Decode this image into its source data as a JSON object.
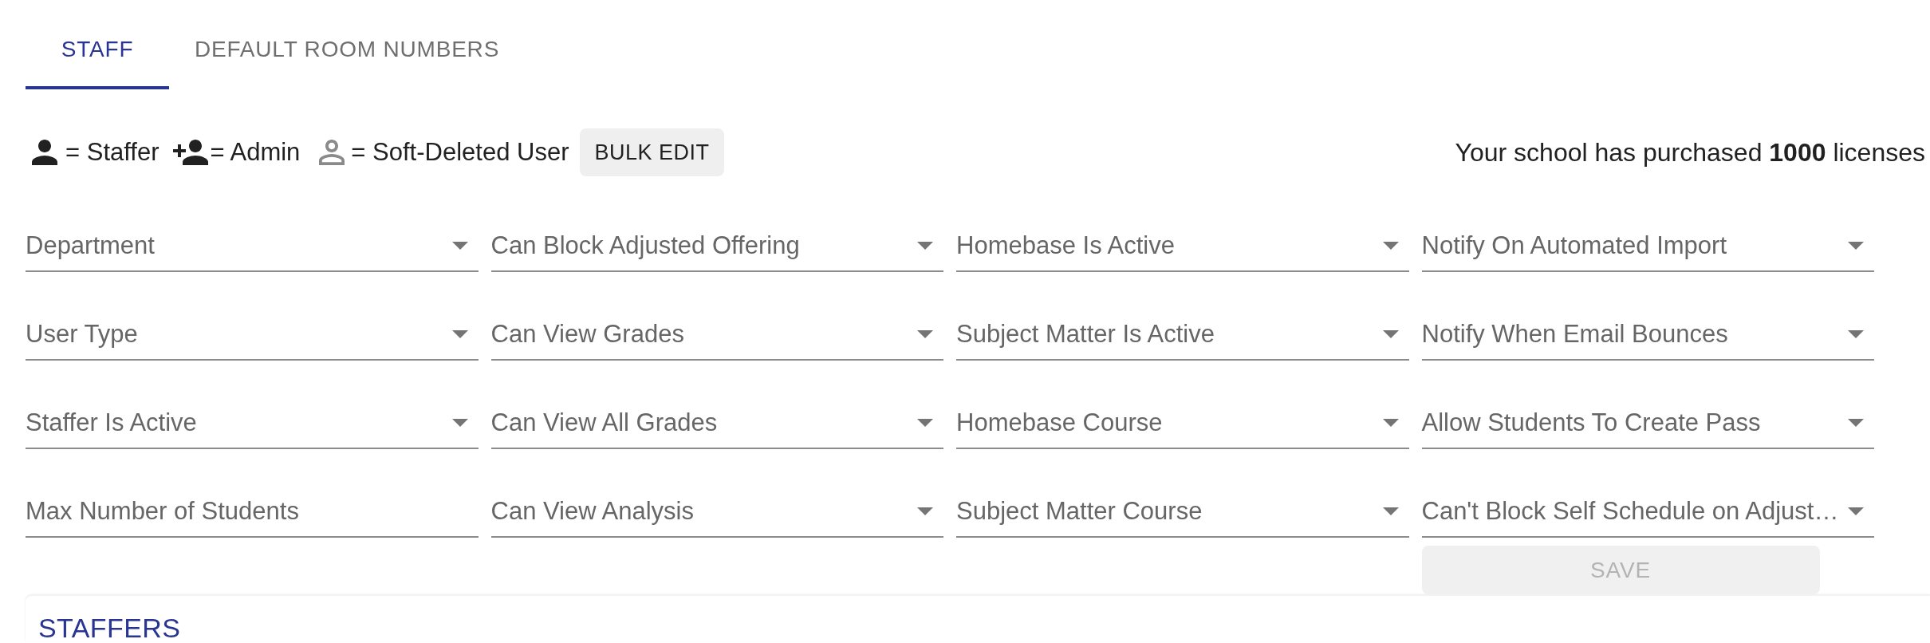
{
  "tabs": [
    {
      "label": "STAFF",
      "selected": true
    },
    {
      "label": "DEFAULT ROOM NUMBERS",
      "selected": false
    }
  ],
  "legend": [
    {
      "kind": "staffer",
      "label": "= Staffer"
    },
    {
      "kind": "admin",
      "label": "= Admin"
    },
    {
      "kind": "soft_deleted",
      "label": "= Soft-Deleted User"
    }
  ],
  "bulk_edit_button": {
    "label": "BULK EDIT"
  },
  "license_note": "Your school has purchased **1000** licenses",
  "filters": [
    {
      "kind": "select",
      "label": "Department"
    },
    {
      "kind": "select",
      "label": "Can Block Adjusted Offering"
    },
    {
      "kind": "select",
      "label": "Homebase Is Active"
    },
    {
      "kind": "select",
      "label": "Notify On Automated Import"
    },
    {
      "kind": "select",
      "label": "User Type"
    },
    {
      "kind": "select",
      "label": "Can View Grades"
    },
    {
      "kind": "select",
      "label": "Subject Matter Is Active"
    },
    {
      "kind": "select",
      "label": "Notify When Email Bounces"
    },
    {
      "kind": "select",
      "label": "Staffer Is Active"
    },
    {
      "kind": "select",
      "label": "Can View All Grades"
    },
    {
      "kind": "select",
      "label": "Homebase Course"
    },
    {
      "kind": "select",
      "label": "Allow Students To Create Pass"
    },
    {
      "kind": "text",
      "label": "Max Number of Students"
    },
    {
      "kind": "select",
      "label": "Can View Analysis"
    },
    {
      "kind": "select",
      "label": "Subject Matter Course"
    },
    {
      "kind": "select",
      "label": "Can't Block Self Schedule on Adjust…"
    }
  ],
  "save_button": {
    "label": "SAVE",
    "disabled": true
  },
  "staffers_panel": {
    "title": "STAFFERS"
  }
}
